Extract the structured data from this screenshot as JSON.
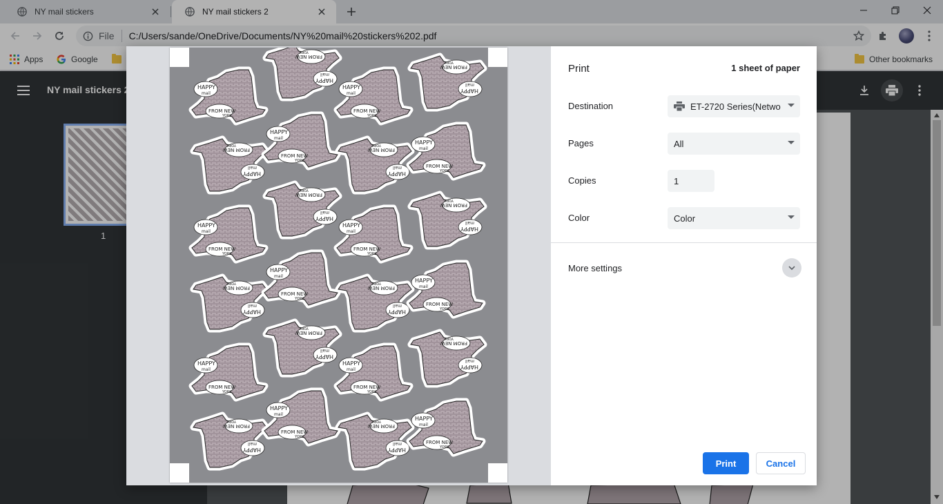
{
  "tabs": [
    {
      "title": "NY mail stickers",
      "active": false
    },
    {
      "title": "NY mail stickers 2",
      "active": true
    }
  ],
  "address": {
    "scheme": "File",
    "url": "C:/Users/sande/OneDrive/Documents/NY%20mail%20stickers%202.pdf"
  },
  "bookmarks": {
    "apps": "Apps",
    "google": "Google",
    "other": "Other bookmarks"
  },
  "pdf": {
    "title": "NY mail stickers 2",
    "page_number": "1"
  },
  "print": {
    "header": "Print",
    "sheet_count": "1 sheet of paper",
    "destination_label": "Destination",
    "destination_value": "ET-2720 Series(Netwo",
    "pages_label": "Pages",
    "pages_value": "All",
    "copies_label": "Copies",
    "copies_value": "1",
    "color_label": "Color",
    "color_value": "Color",
    "more_settings": "More settings",
    "print_button": "Print",
    "cancel_button": "Cancel"
  },
  "sticker_lettering": [
    "HAPPY",
    "mail",
    "FROM",
    "NEW",
    "YORK"
  ],
  "colors": {
    "accent": "#1a73e8",
    "pdf_toolbar": "#323639",
    "sticker_fill": "#b3a6ad",
    "sheet_bg": "#8b8c90"
  }
}
